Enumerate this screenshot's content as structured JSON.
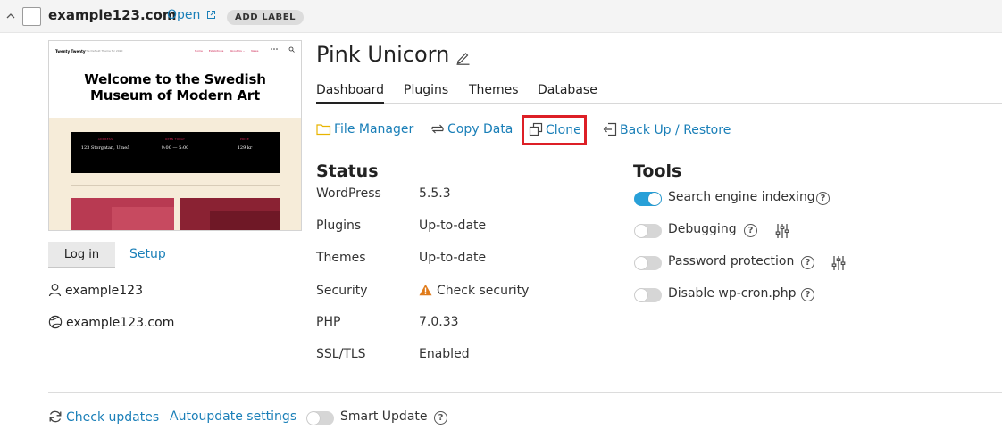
{
  "header": {
    "domain": "example123.com",
    "open_label": "Open",
    "add_label": "ADD LABEL"
  },
  "preview": {
    "site_title": "Twenty Twenty",
    "tagline": "The Default Theme for 2020",
    "nav": [
      "Home",
      "Exhibitions",
      "About Us ⌄",
      "News"
    ],
    "heading_line1": "Welcome to the Swedish",
    "heading_line2": "Museum of Modern Art",
    "info": [
      {
        "key": "ADDRESS",
        "value": "123 Storgatan, Umeå"
      },
      {
        "key": "OPEN TODAY",
        "value": "9:00 — 5:00"
      },
      {
        "key": "PRICE",
        "value": "129 kr"
      }
    ]
  },
  "left": {
    "login_label": "Log in",
    "setup_label": "Setup",
    "username": "example123",
    "site_url": "example123.com"
  },
  "site": {
    "name": "Pink Unicorn"
  },
  "tabs": [
    {
      "label": "Dashboard",
      "active": true
    },
    {
      "label": "Plugins",
      "active": false
    },
    {
      "label": "Themes",
      "active": false
    },
    {
      "label": "Database",
      "active": false
    }
  ],
  "actions": {
    "file_manager": "File Manager",
    "copy_data": "Copy Data",
    "clone": "Clone",
    "backup_restore": "Back Up / Restore"
  },
  "status": {
    "title": "Status",
    "rows": [
      {
        "label": "WordPress",
        "value": "5.5.3"
      },
      {
        "label": "Plugins",
        "value": "Up-to-date"
      },
      {
        "label": "Themes",
        "value": "Up-to-date"
      },
      {
        "label": "Security",
        "value": "Check security"
      },
      {
        "label": "PHP",
        "value": "7.0.33"
      },
      {
        "label": "SSL/TLS",
        "value": "Enabled"
      }
    ]
  },
  "tools": {
    "title": "Tools",
    "items": [
      {
        "label": "Search engine indexing",
        "on": true
      },
      {
        "label": "Debugging",
        "on": false
      },
      {
        "label": "Password protection",
        "on": false
      },
      {
        "label": "Disable wp-cron.php",
        "on": false
      }
    ]
  },
  "footer": {
    "check_updates": "Check updates",
    "autoupdate": "Autoupdate settings",
    "smart_update": "Smart Update"
  },
  "colors": {
    "link": "#1a7fb8",
    "toggle_on": "#28a0d8",
    "highlight": "#dd1f26",
    "warning": "#e07b1a",
    "folder": "#e8b400"
  }
}
